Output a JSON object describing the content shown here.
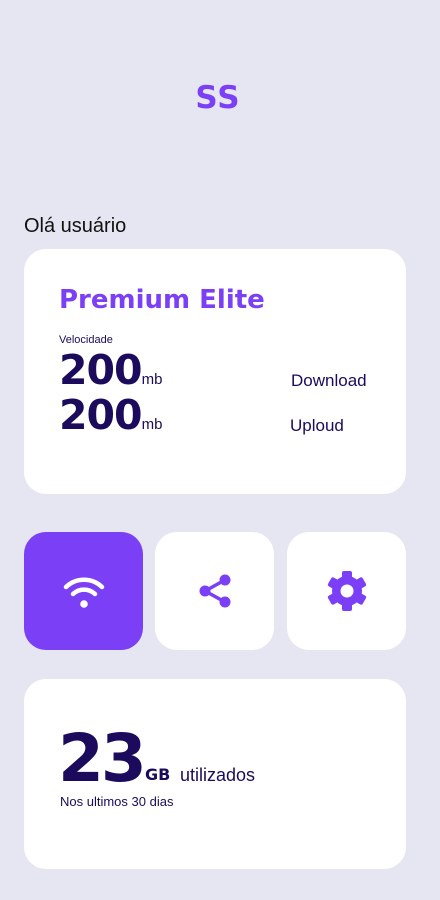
{
  "app": {
    "logo": "SS"
  },
  "greeting": "Olá usuário",
  "plan": {
    "name": "Premium Elite",
    "speed_label": "Velocidade",
    "download": {
      "value": "200",
      "unit": "mb",
      "label": "Download"
    },
    "upload": {
      "value": "200",
      "unit": "mb",
      "label": "Uploud"
    }
  },
  "actions": [
    {
      "icon": "wifi-icon",
      "active": true
    },
    {
      "icon": "share-icon",
      "active": false
    },
    {
      "icon": "gear-icon",
      "active": false
    }
  ],
  "usage": {
    "value": "23",
    "unit": "GB",
    "label": "utilizados",
    "period": "Nos ultimos 30 dias"
  },
  "colors": {
    "background": "#e6e6f2",
    "accent": "#7b3ff6",
    "text_dark": "#1c0a5c",
    "card": "#ffffff"
  }
}
